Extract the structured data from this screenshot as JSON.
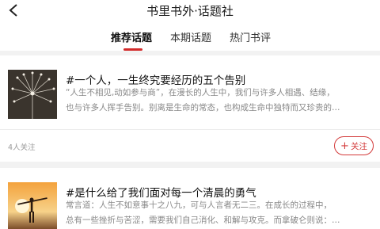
{
  "header": {
    "title": "书里书外·话题社"
  },
  "tabs": [
    {
      "label": "推荐话题",
      "active": true
    },
    {
      "label": "本期话题",
      "active": false
    },
    {
      "label": "热门书评",
      "active": false
    }
  ],
  "accent_color": "#d32b2b",
  "topics": [
    {
      "title": "#一个人，一生终究要经历的五个告别",
      "desc_lines": [
        "“人生不相见,动如参与商”，在漫长的人生中，我们与许多人相遇、结缘，",
        "也与许多人挥手告别。别离是生命的常态，也构成生命中独特而又珍贵的…"
      ],
      "followers": "4人关注",
      "follow_label": "关注",
      "thumb_icon": "dandelion-photo"
    },
    {
      "title": "#是什么给了我们面对每一个清晨的勇气",
      "desc_lines": [
        "常言道：人生不如意事十之八九，可与人言者无二三。在成长的过程中，",
        "总有一些挫折与苦涩，需要我们自己消化、和解与攻克。而拿破仑则说：…"
      ],
      "thumb_icon": "sunrise-photo"
    }
  ]
}
